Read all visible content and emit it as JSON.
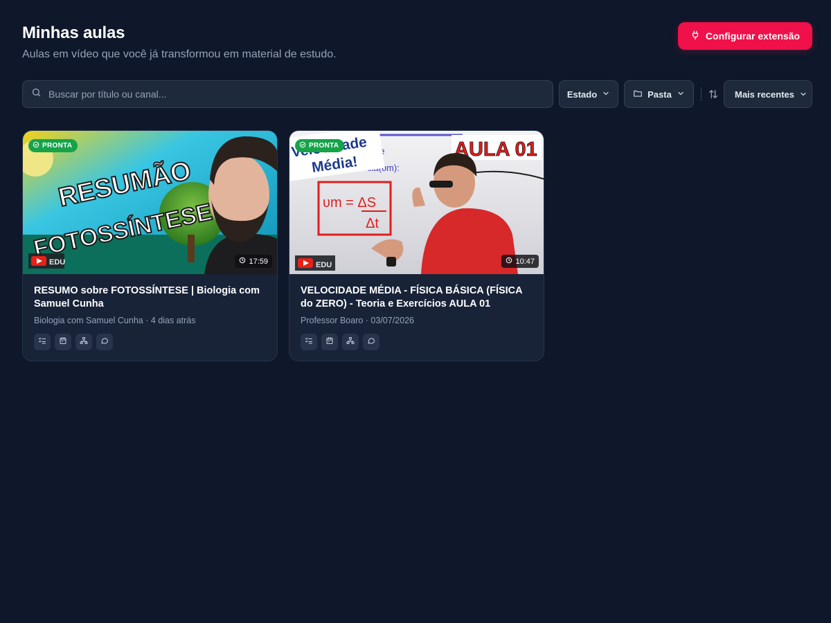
{
  "header": {
    "title": "Minhas aulas",
    "subtitle": "Aulas em vídeo que você já transformou em material de estudo.",
    "cta_label": "Configurar extensão"
  },
  "filters": {
    "search_placeholder": "Buscar por título ou canal...",
    "status_label": "Estado",
    "folder_label": "Pasta",
    "sort_label": "Mais recentes"
  },
  "colors": {
    "background": "#0f172a",
    "accent": "#f0104a",
    "ready_badge": "#16a34a",
    "card": "#182338"
  },
  "cards": [
    {
      "status": "PRONTA",
      "duration": "17:59",
      "thumb_text_line1": "RESUMÃO",
      "thumb_text_line2": "FOTOSSÍNTESE",
      "thumb_logo": "EDU",
      "title": "RESUMO sobre FOTOSSÍNTESE | Biologia com Samuel Cunha",
      "meta": "Biologia com Samuel Cunha · 4 dias atrás",
      "actions": [
        "checklist-icon",
        "calendar-icon",
        "mindmap-icon",
        "chat-icon"
      ]
    },
    {
      "status": "PRONTA",
      "duration": "10:47",
      "thumb_text_line1": "Velocidade",
      "thumb_text_line2": "Média!",
      "thumb_heading": "AULA 01",
      "thumb_formula_top": "υm = ΔS",
      "thumb_formula_bottom": "Δt",
      "thumb_logo": "EDU",
      "title": "VELOCIDADE MÉDIA - FÍSICA BÁSICA (FÍSICA do ZERO) - Teoria e Exercícios AULA 01",
      "meta": "Professor Boaro · 03/07/2026",
      "actions": [
        "checklist-icon",
        "calendar-icon",
        "mindmap-icon",
        "chat-icon"
      ]
    }
  ]
}
